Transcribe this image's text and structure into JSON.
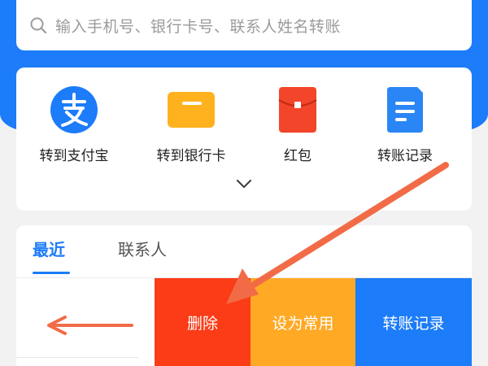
{
  "search": {
    "placeholder": "输入手机号、银行卡号、联系人姓名转账",
    "icon": "search-icon"
  },
  "quick_actions": [
    {
      "label": "转到支付宝",
      "icon": "alipay-icon",
      "color": "#1c7cf9"
    },
    {
      "label": "转到银行卡",
      "icon": "bank-card-icon",
      "color": "#ffb21e"
    },
    {
      "label": "红包",
      "icon": "red-envelope-icon",
      "color": "#f2452a"
    },
    {
      "label": "转账记录",
      "icon": "transfer-record-icon",
      "color": "#2a86f5"
    }
  ],
  "expand_icon": "chevron-down-icon",
  "tabs": [
    {
      "label": "最近",
      "active": true
    },
    {
      "label": "联系人",
      "active": false
    }
  ],
  "swipe_actions": {
    "delete": "删除",
    "set_frequent": "设为常用",
    "transfer_record": "转账记录"
  },
  "colors": {
    "brand_blue": "#1c7cf9",
    "delete_red": "#fb3c16",
    "frequent_orange": "#ffa925",
    "annotation_arrow": "#f26b47"
  }
}
